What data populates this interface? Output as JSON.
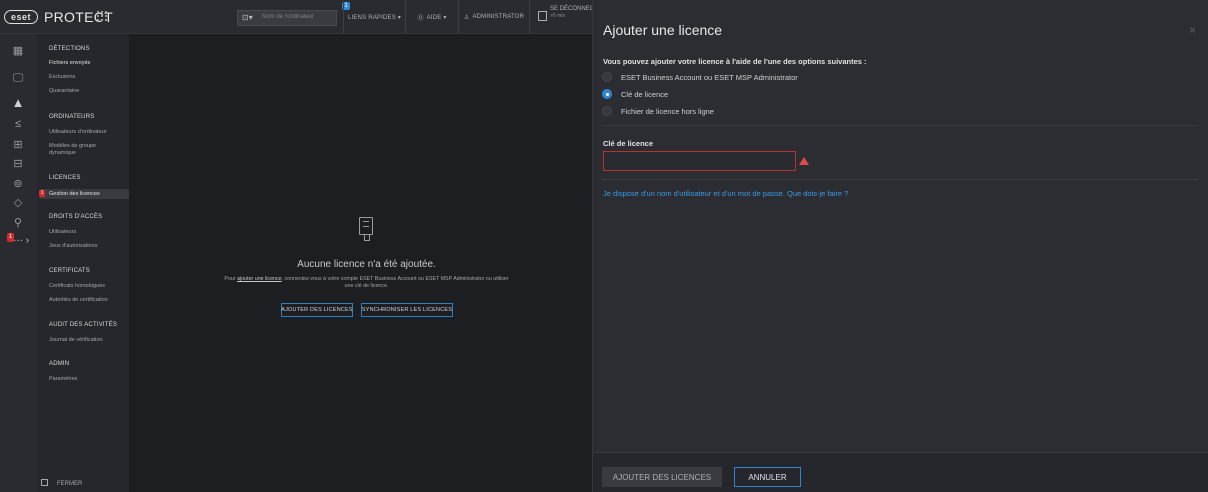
{
  "topbar": {
    "logo": "eset",
    "product": "PROTECT",
    "apps_icon": "grid-dots-icon",
    "search_placeholder": "Nom de l'ordinateur",
    "quick_links": "LIENS RAPIDES ▾",
    "quick_links_badge": "1",
    "help": "AIDE ▾",
    "user": "ADMINISTRATOR",
    "logout": "SE DÉCONNECT",
    "logout_time": ">9 min"
  },
  "rail": {
    "icons": [
      "dashboard-icon",
      "computers-icon",
      "detections-icon",
      "reports-icon",
      "tasks-icon",
      "installers-icon",
      "policies-icon",
      "notifications-icon",
      "status-icon"
    ],
    "badge": "1",
    "expand": "›"
  },
  "menu": {
    "sections": [
      {
        "head": "DÉTECTIONS",
        "items": [
          "Fichiers envoyés",
          "Exclusions",
          "Quarantaine"
        ]
      },
      {
        "head": "ORDINATEURS",
        "items": [
          "Utilisateurs d'ordinateur",
          "Modèles de groupe dynamique"
        ]
      },
      {
        "head": "LICENCES",
        "items": [
          "Gestion des licences"
        ]
      },
      {
        "head": "DROITS D'ACCÈS",
        "items": [
          "Utilisateurs",
          "Jeux d'autorisations"
        ]
      },
      {
        "head": "CERTIFICATS",
        "items": [
          "Certificats homologues",
          "Autorités de certification"
        ]
      },
      {
        "head": "AUDIT DES ACTIVITÉS",
        "items": [
          "Journal de vérification"
        ]
      },
      {
        "head": "ADMIN",
        "items": [
          "Paramètres"
        ]
      }
    ],
    "badge": "1",
    "close": "FERMER"
  },
  "main": {
    "empty_title": "Aucune licence n'a été ajoutée.",
    "desc_prefix": "Pour ",
    "desc_link": "ajouter une licence",
    "desc_suffix": ", connectez-vous à votre compte ESET Business Account ou ESET MSP Administrator ou utiliser une clé de licence.",
    "add_button": "AJOUTER DES LICENCES",
    "sync_button": "SYNCHRONISER LES LICENCES"
  },
  "dialog": {
    "title": "Ajouter une licence",
    "close": "×",
    "prompt": "Vous pouvez ajouter votre licence à l'aide de l'une des options suivantes :",
    "options": [
      "ESET Business Account ou ESET MSP Administrator",
      "Clé de licence",
      "Fichier de licence hors ligne"
    ],
    "selected_option": 1,
    "field_label": "Clé de licence",
    "field_value": "",
    "help_link": "Je dispose d'un nom d'utilisateur et d'un mot de passe. Que dois-je faire ?",
    "primary_button": "AJOUTER DES LICENCES",
    "cancel_button": "ANNULER"
  },
  "colors": {
    "accent": "#2f86d0",
    "error": "#b73131",
    "link": "#3a9ae4"
  }
}
